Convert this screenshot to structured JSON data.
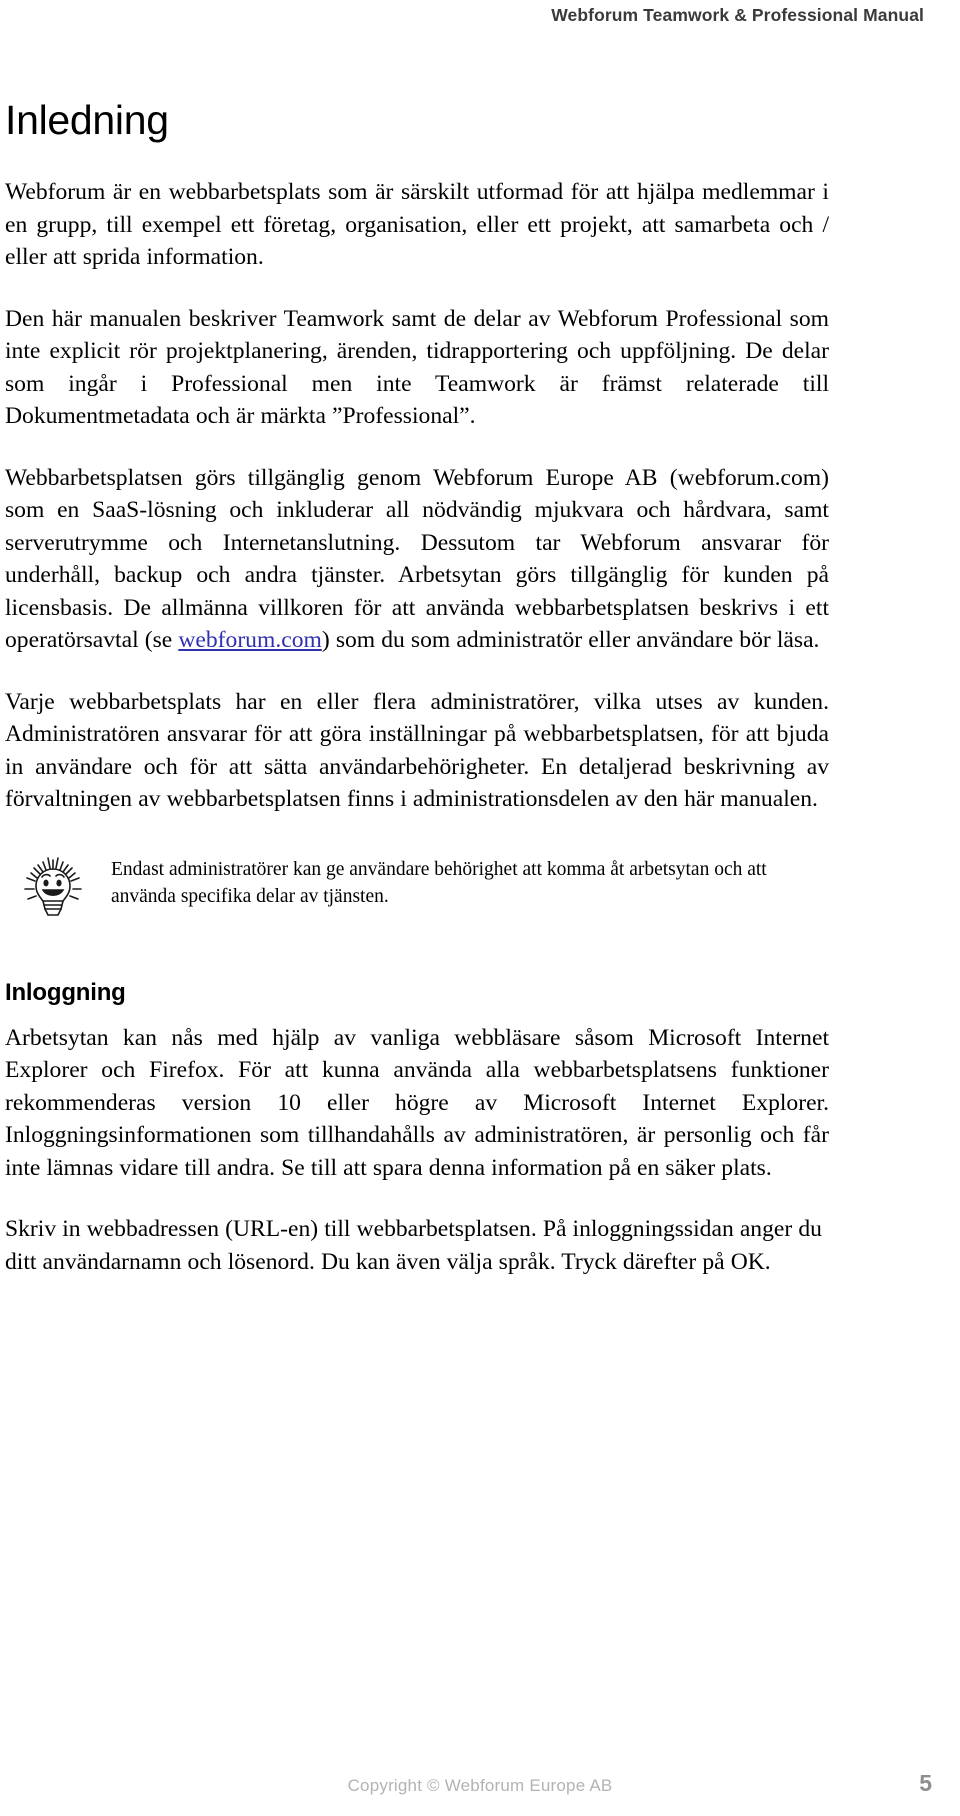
{
  "header": {
    "running_title": "Webforum Teamwork & Professional Manual"
  },
  "sections": {
    "inledning": {
      "title": "Inledning",
      "p1": "Webforum är en webbarbetsplats som är särskilt utformad för att hjälpa medlemmar i en grupp, till exempel ett företag, organisation, eller ett projekt, att samarbeta och / eller att sprida information.",
      "p2": "Den här manualen beskriver Teamwork samt de delar av Webforum Professional som inte explicit rör projektplanering, ärenden, tidrapportering och uppföljning. De delar som ingår i Professional men inte Teamwork är främst relaterade till Dokumentmetadata och är märkta ”Professional”.",
      "p3_a": "Webbarbetsplatsen görs tillgänglig genom Webforum Europe AB (webforum.com) som en SaaS-lösning och inkluderar all nödvändig mjukvara och hårdvara, samt serverutrymme och Internetanslutning. Dessutom tar Webforum ansvarar för underhåll, backup och andra tjänster. Arbetsytan görs tillgänglig för kunden på licensbasis. De allmänna villkoren för att använda webbarbetsplatsen beskrivs i ett operatörsavtal (se ",
      "p3_link": "webforum.com",
      "p3_b": ") som du som administratör eller användare bör läsa.",
      "p4": "Varje webbarbetsplats har en eller flera administratörer, vilka utses av kunden. Administratören ansvarar för att göra inställningar på webbarbetsplatsen, för att bjuda in användare och för att sätta användarbehörigheter. En detaljerad beskrivning av förvaltningen av webbarbetsplatsen finns i administrationsdelen av den här manualen.",
      "tip": {
        "icon": "lightbulb-face-icon",
        "text": "Endast administratörer kan ge användare behörighet att komma åt arbetsytan och att använda specifika delar av tjänsten."
      }
    },
    "inloggning": {
      "title": "Inloggning",
      "p1": "Arbetsytan kan nås med hjälp av vanliga webbläsare såsom Microsoft Internet Explorer och Firefox. För att kunna använda alla webbarbetsplatsens funktioner rekommenderas version 10 eller högre av Microsoft Internet Explorer. Inloggningsinformationen som tillhandahålls av administratören, är personlig och får inte lämnas vidare till andra. Se till att spara denna information på en säker plats.",
      "p2": "Skriv in webbadressen (URL-en) till webbarbetsplatsen. På inloggningssidan anger du ditt användarnamn och lösenord. Du kan även välja språk. Tryck därefter på OK."
    }
  },
  "footer": {
    "copyright": "Copyright © Webforum Europe AB",
    "page_number": "5"
  },
  "colors": {
    "link": "#3030b0",
    "header_text": "#3a3a3a",
    "footer_text": "#b3b3b3",
    "page_number": "#8e8e8e",
    "body_text": "#000000"
  }
}
